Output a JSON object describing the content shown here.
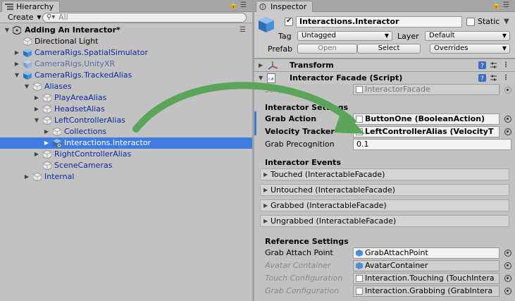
{
  "hierarchy": {
    "tab_label": "Hierarchy",
    "create_label": "Create",
    "search_placeholder": "All",
    "scene_name": "Adding An Interactor*",
    "items": [
      {
        "label": "Directional Light"
      },
      {
        "label": "CameraRigs.SpatialSimulator"
      },
      {
        "label": "CameraRigs.UnityXR"
      },
      {
        "label": "CameraRigs.TrackedAlias"
      },
      {
        "label": "Aliases"
      },
      {
        "label": "PlayAreaAlias"
      },
      {
        "label": "HeadsetAlias"
      },
      {
        "label": "LeftControllerAlias"
      },
      {
        "label": "Collections"
      },
      {
        "label": "Interactions.Interactor"
      },
      {
        "label": "RightControllerAlias"
      },
      {
        "label": "SceneCameras"
      },
      {
        "label": "Internal"
      }
    ]
  },
  "inspector": {
    "tab_label": "Inspector",
    "object_name": "Interactions.Interactor",
    "static_label": "Static",
    "tag_label": "Tag",
    "tag_value": "Untagged",
    "layer_label": "Layer",
    "layer_value": "Default",
    "prefab_label": "Prefab",
    "open_label": "Open",
    "select_label": "Select",
    "overrides_label": "Overrides",
    "transform_title": "Transform",
    "facade_title": "Interactor Facade (Script)",
    "script_label": "Script",
    "script_value": "InteractorFacade",
    "interactor_settings_title": "Interactor Settings",
    "grab_action_label": "Grab Action",
    "grab_action_value": "ButtonOne (BooleanAction)",
    "velocity_tracker_label": "Velocity Tracker",
    "velocity_tracker_value": "LeftControllerAlias (VelocityT",
    "grab_precognition_label": "Grab Precognition",
    "grab_precognition_value": "0.1",
    "interactor_events_title": "Interactor Events",
    "events": [
      "Touched (InteractableFacade)",
      "Untouched (InteractableFacade)",
      "Grabbed (InteractableFacade)",
      "Ungrabbed (InteractableFacade)"
    ],
    "reference_settings_title": "Reference Settings",
    "refs": [
      {
        "label": "Grab Attach Point",
        "value": "GrabAttachPoint"
      },
      {
        "label": "Avatar Container",
        "value": "AvatarContainer"
      },
      {
        "label": "Touch Configuration",
        "value": "Interaction.Touching (TouchIntera"
      },
      {
        "label": "Grab Configuration",
        "value": "Interaction.Grabbing (GrabIntera"
      }
    ]
  },
  "colors": {
    "selection": "#3e7ce4",
    "arrow": "#5aa55a",
    "prefab_text": "#0a2a9c"
  }
}
